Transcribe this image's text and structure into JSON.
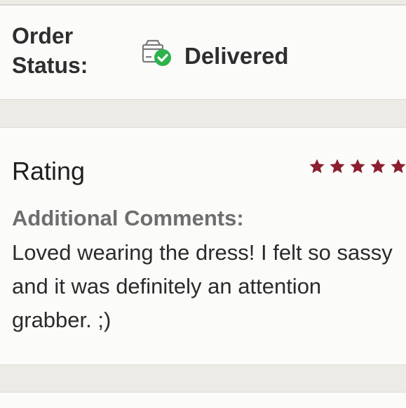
{
  "order": {
    "status_label": "Order Status:",
    "status_value": "Delivered",
    "status_icon": "package-delivered-icon",
    "check_color": "#2fb24b"
  },
  "review": {
    "rating_label": "Rating",
    "rating": 5,
    "rating_max": 5,
    "star_color": "#8b1e2f",
    "comments_label": "Additional Comments:",
    "comments_text": "Loved wearing the dress! I felt so sassy and it was definitely an attention grabber. ;)"
  }
}
